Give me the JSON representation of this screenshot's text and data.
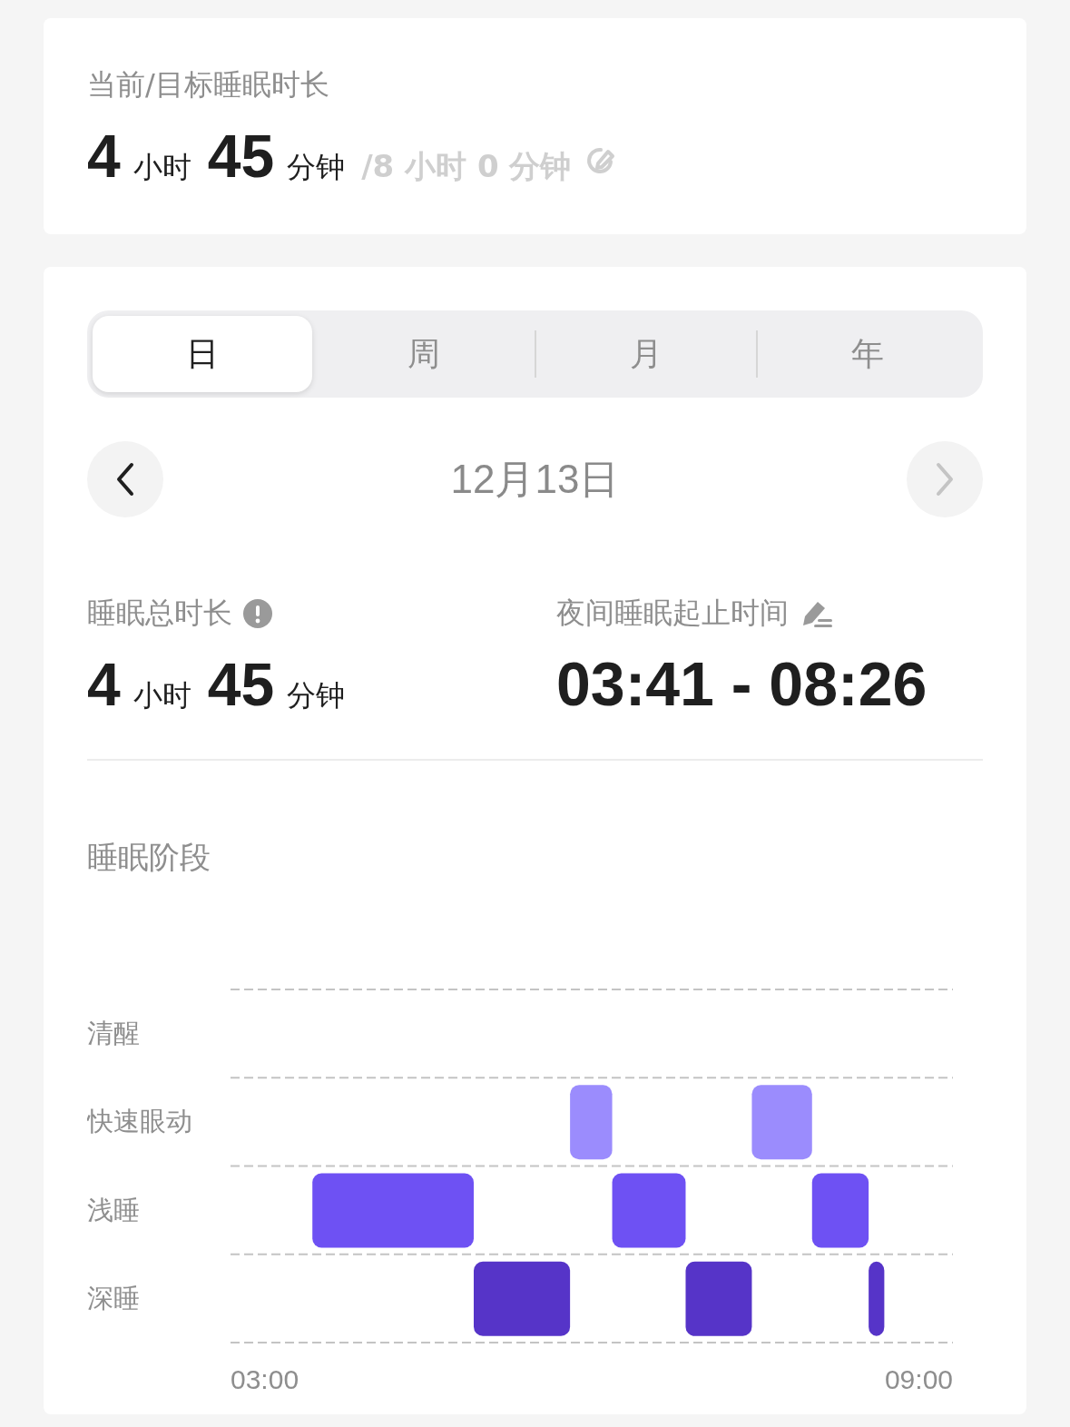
{
  "goal_card": {
    "title": "当前/目标睡眠时长",
    "hours": "4",
    "hours_unit": "小时",
    "minutes": "45",
    "minutes_unit": "分钟",
    "target": "/8 小时 0 分钟"
  },
  "tabs": [
    {
      "label": "日",
      "selected": true
    },
    {
      "label": "周",
      "selected": false
    },
    {
      "label": "月",
      "selected": false
    },
    {
      "label": "年",
      "selected": false
    }
  ],
  "date_nav": {
    "date": "12月13日",
    "prev_disabled": false,
    "next_disabled": true
  },
  "total": {
    "label": "睡眠总时长",
    "hours": "4",
    "hours_unit": "小时",
    "minutes": "45",
    "minutes_unit": "分钟"
  },
  "night": {
    "label": "夜间睡眠起止时间",
    "range": "03:41 - 08:26"
  },
  "stages": {
    "title": "睡眠阶段",
    "levels": [
      "清醒",
      "快速眼动",
      "浅睡",
      "深睡"
    ],
    "time_labels": [
      "03:00",
      "09:00"
    ]
  }
}
